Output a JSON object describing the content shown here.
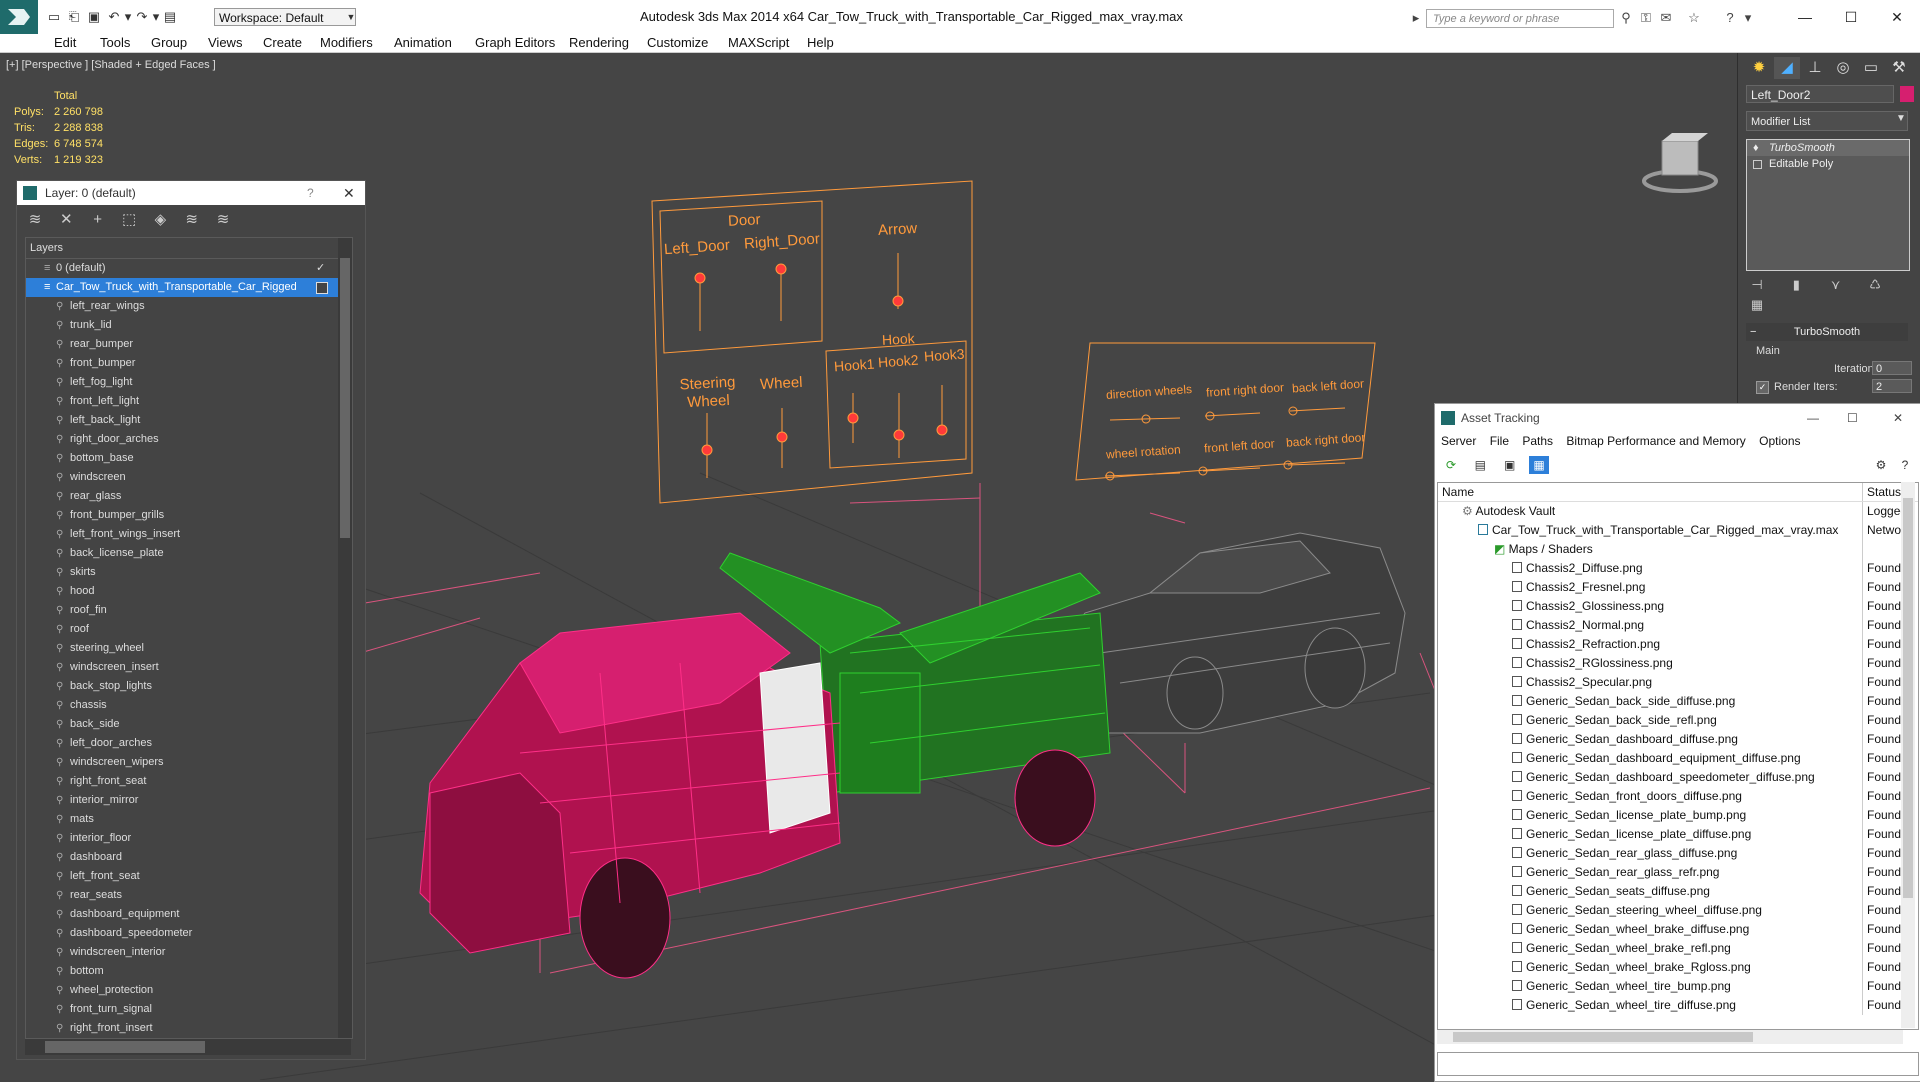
{
  "app": {
    "window_title": "Autodesk 3ds Max  2014 x64      Car_Tow_Truck_with_Transportable_Car_Rigged_max_vray.max",
    "workspace": "Workspace: Default",
    "search_placeholder": "Type a keyword or phrase"
  },
  "menu": [
    "Edit",
    "Tools",
    "Group",
    "Views",
    "Create",
    "Modifiers",
    "Animation",
    "Graph Editors",
    "Rendering",
    "Customize",
    "MAXScript",
    "Help"
  ],
  "viewport": {
    "label": "[+] [Perspective ] [Shaded + Edged Faces ]",
    "stats": {
      "header": "Total",
      "polys_label": "Polys:",
      "polys": "2 260 798",
      "tris_label": "Tris:",
      "tris": "2 288 838",
      "edges_label": "Edges:",
      "edges": "6 748 574",
      "verts_label": "Verts:",
      "verts": "1 219 323"
    },
    "rig_panel_1": {
      "door": "Door",
      "left_door": "Left_Door",
      "right_door": "Right_Door",
      "arrow": "Arrow",
      "steering_wheel": "Steering Wheel",
      "wheel": "Wheel",
      "hook": "Hook",
      "hook1": "Hook1",
      "hook2": "Hook2",
      "hook3": "Hook3"
    },
    "rig_panel_2": {
      "direction_wheels": "direction wheels",
      "front_right_door": "front right door",
      "back_left_door": "back left door",
      "wheel_rotation": "wheel rotation",
      "front_left_door": "front left door",
      "back_right_door": "back right door"
    }
  },
  "layer_panel": {
    "title": "Layer: 0 (default)",
    "help": "?",
    "column_header": "Layers",
    "default_layer": "0 (default)",
    "selected_layer": "Car_Tow_Truck_with_Transportable_Car_Rigged",
    "items": [
      "left_rear_wings",
      "trunk_lid",
      "rear_bumper",
      "front_bumper",
      "left_fog_light",
      "front_left_light",
      "left_back_light",
      "right_door_arches",
      "bottom_base",
      "windscreen",
      "rear_glass",
      "front_bumper_grills",
      "left_front_wings_insert",
      "back_license_plate",
      "skirts",
      "hood",
      "roof_fin",
      "roof",
      "steering_wheel",
      "windscreen_insert",
      "back_stop_lights",
      "chassis",
      "back_side",
      "left_door_arches",
      "windscreen_wipers",
      "right_front_seat",
      "interior_mirror",
      "mats",
      "interior_floor",
      "dashboard",
      "left_front_seat",
      "rear_seats",
      "dashboard_equipment",
      "dashboard_speedometer",
      "windscreen_interior",
      "bottom",
      "wheel_protection",
      "front_turn_signal",
      "right_front_insert"
    ]
  },
  "command_panel": {
    "object_name": "Left_Door2",
    "object_color": "#d61f6f",
    "modifier_list": "Modifier List",
    "stack": [
      "TurboSmooth",
      "Editable Poly"
    ],
    "rollout": "TurboSmooth",
    "group": "Main",
    "iterations_label": "Iterations:",
    "iterations": "0",
    "render_iters_label": "Render Iters:",
    "render_iters": "2"
  },
  "asset_tracking": {
    "title": "Asset Tracking",
    "menu": [
      "Server",
      "File",
      "Paths",
      "Bitmap Performance and Memory",
      "Options"
    ],
    "col_name": "Name",
    "col_status": "Status",
    "vault": {
      "name": "Autodesk Vault",
      "status": "Logged"
    },
    "file": {
      "name": "Car_Tow_Truck_with_Transportable_Car_Rigged_max_vray.max",
      "status": "Networ"
    },
    "maps": "Maps / Shaders",
    "found": "Found",
    "files": [
      "Chassis2_Diffuse.png",
      "Chassis2_Fresnel.png",
      "Chassis2_Glossiness.png",
      "Chassis2_Normal.png",
      "Chassis2_Refraction.png",
      "Chassis2_RGlossiness.png",
      "Chassis2_Specular.png",
      "Generic_Sedan_back_side_diffuse.png",
      "Generic_Sedan_back_side_refl.png",
      "Generic_Sedan_dashboard_diffuse.png",
      "Generic_Sedan_dashboard_equipment_diffuse.png",
      "Generic_Sedan_dashboard_speedometer_diffuse.png",
      "Generic_Sedan_front_doors_diffuse.png",
      "Generic_Sedan_license_plate_bump.png",
      "Generic_Sedan_license_plate_diffuse.png",
      "Generic_Sedan_rear_glass_diffuse.png",
      "Generic_Sedan_rear_glass_refr.png",
      "Generic_Sedan_seats_diffuse.png",
      "Generic_Sedan_steering_wheel_diffuse.png",
      "Generic_Sedan_wheel_brake_diffuse.png",
      "Generic_Sedan_wheel_brake_refl.png",
      "Generic_Sedan_wheel_brake_Rgloss.png",
      "Generic_Sedan_wheel_tire_bump.png",
      "Generic_Sedan_wheel_tire_diffuse.png"
    ]
  },
  "colors": {
    "selection": "#2d7fd9",
    "truck_wire": "#d61f6f",
    "rig_wire": "#22c022",
    "controls": "#ff9a3c",
    "stats": "#ffe066"
  }
}
